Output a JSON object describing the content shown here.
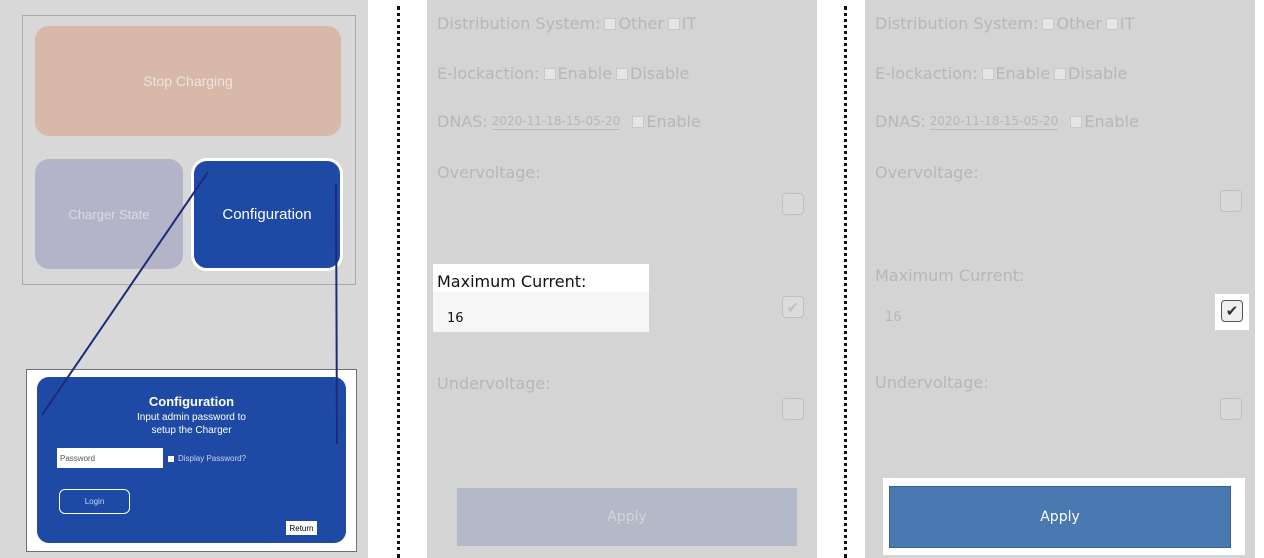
{
  "panel1": {
    "stop_charging": "Stop Charging",
    "charger_state": "Charger State",
    "configuration": "Configuration",
    "login": {
      "title": "Configuration",
      "subtitle_line1": "Input admin password to",
      "subtitle_line2": "setup the Charger",
      "password_placeholder": "Password",
      "display_password": "Display Password?",
      "login_button": "Login",
      "return_button": "Return"
    }
  },
  "config_screen": {
    "distribution_label": "Distribution System:",
    "option_other": "Other",
    "option_it": "IT",
    "elock_label": "E-lockaction:",
    "option_enable": "Enable",
    "option_disable": "Disable",
    "dnas_label": "DNAS:",
    "dnas_value": "2020-11-18-15-05-20",
    "dnas_enable": "Enable",
    "overvoltage_label": "Overvoltage:",
    "max_current_label": "Maximum Current:",
    "max_current_value": "16",
    "undervoltage_label": "Undervoltage:",
    "apply_button": "Apply"
  },
  "icons": {
    "check": "check-icon"
  },
  "colors": {
    "brand_blue": "#1e4aa6",
    "apply_active": "#4a78b0",
    "stop_button": "#d8b8a8"
  }
}
